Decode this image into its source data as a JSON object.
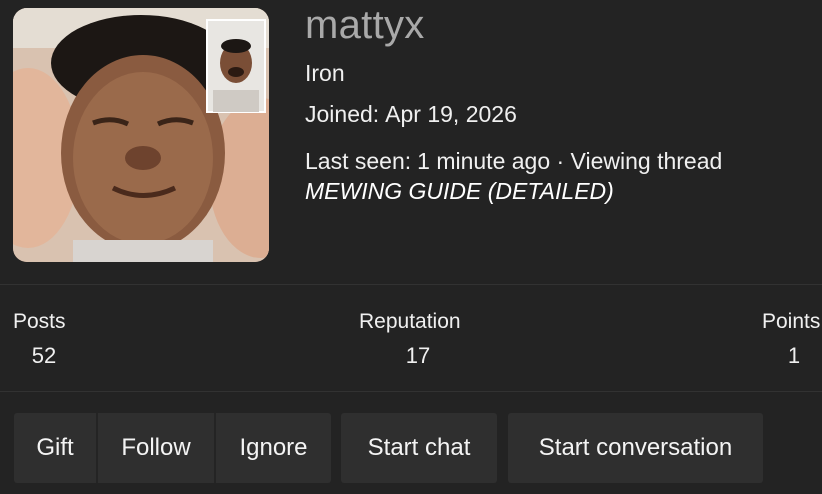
{
  "profile": {
    "username": "mattyx",
    "rank": "Iron",
    "joined_label": "Joined:",
    "joined_date": "Apr 19, 2026",
    "last_seen_label": "Last seen:",
    "last_seen_text": "1 minute ago · Viewing thread",
    "thread_title": "MEWING GUIDE (DETAILED)"
  },
  "stats": {
    "posts": {
      "label": "Posts",
      "value": "52"
    },
    "reputation": {
      "label": "Reputation",
      "value": "17"
    },
    "points": {
      "label": "Points",
      "value": "1"
    }
  },
  "actions": {
    "gift": "Gift",
    "follow": "Follow",
    "ignore": "Ignore",
    "start_chat": "Start chat",
    "start_conversation": "Start conversation"
  },
  "colors": {
    "background": "#232323",
    "button": "#2f2f2f",
    "username": "#a9a9a9",
    "text": "#f0f0f0"
  }
}
